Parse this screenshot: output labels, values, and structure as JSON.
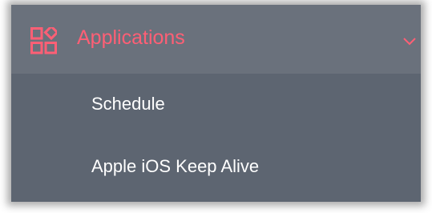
{
  "menu": {
    "header": {
      "label": "Applications",
      "icon": "applications-grid-icon",
      "expand_icon": "chevron-down-icon",
      "accent_color": "#ff5f75"
    },
    "items": [
      {
        "label": "Schedule"
      },
      {
        "label": "Apple iOS Keep Alive"
      }
    ],
    "colors": {
      "header_background": "#6a717c",
      "submenu_background": "#5d6571",
      "item_text": "#ffffff"
    }
  }
}
